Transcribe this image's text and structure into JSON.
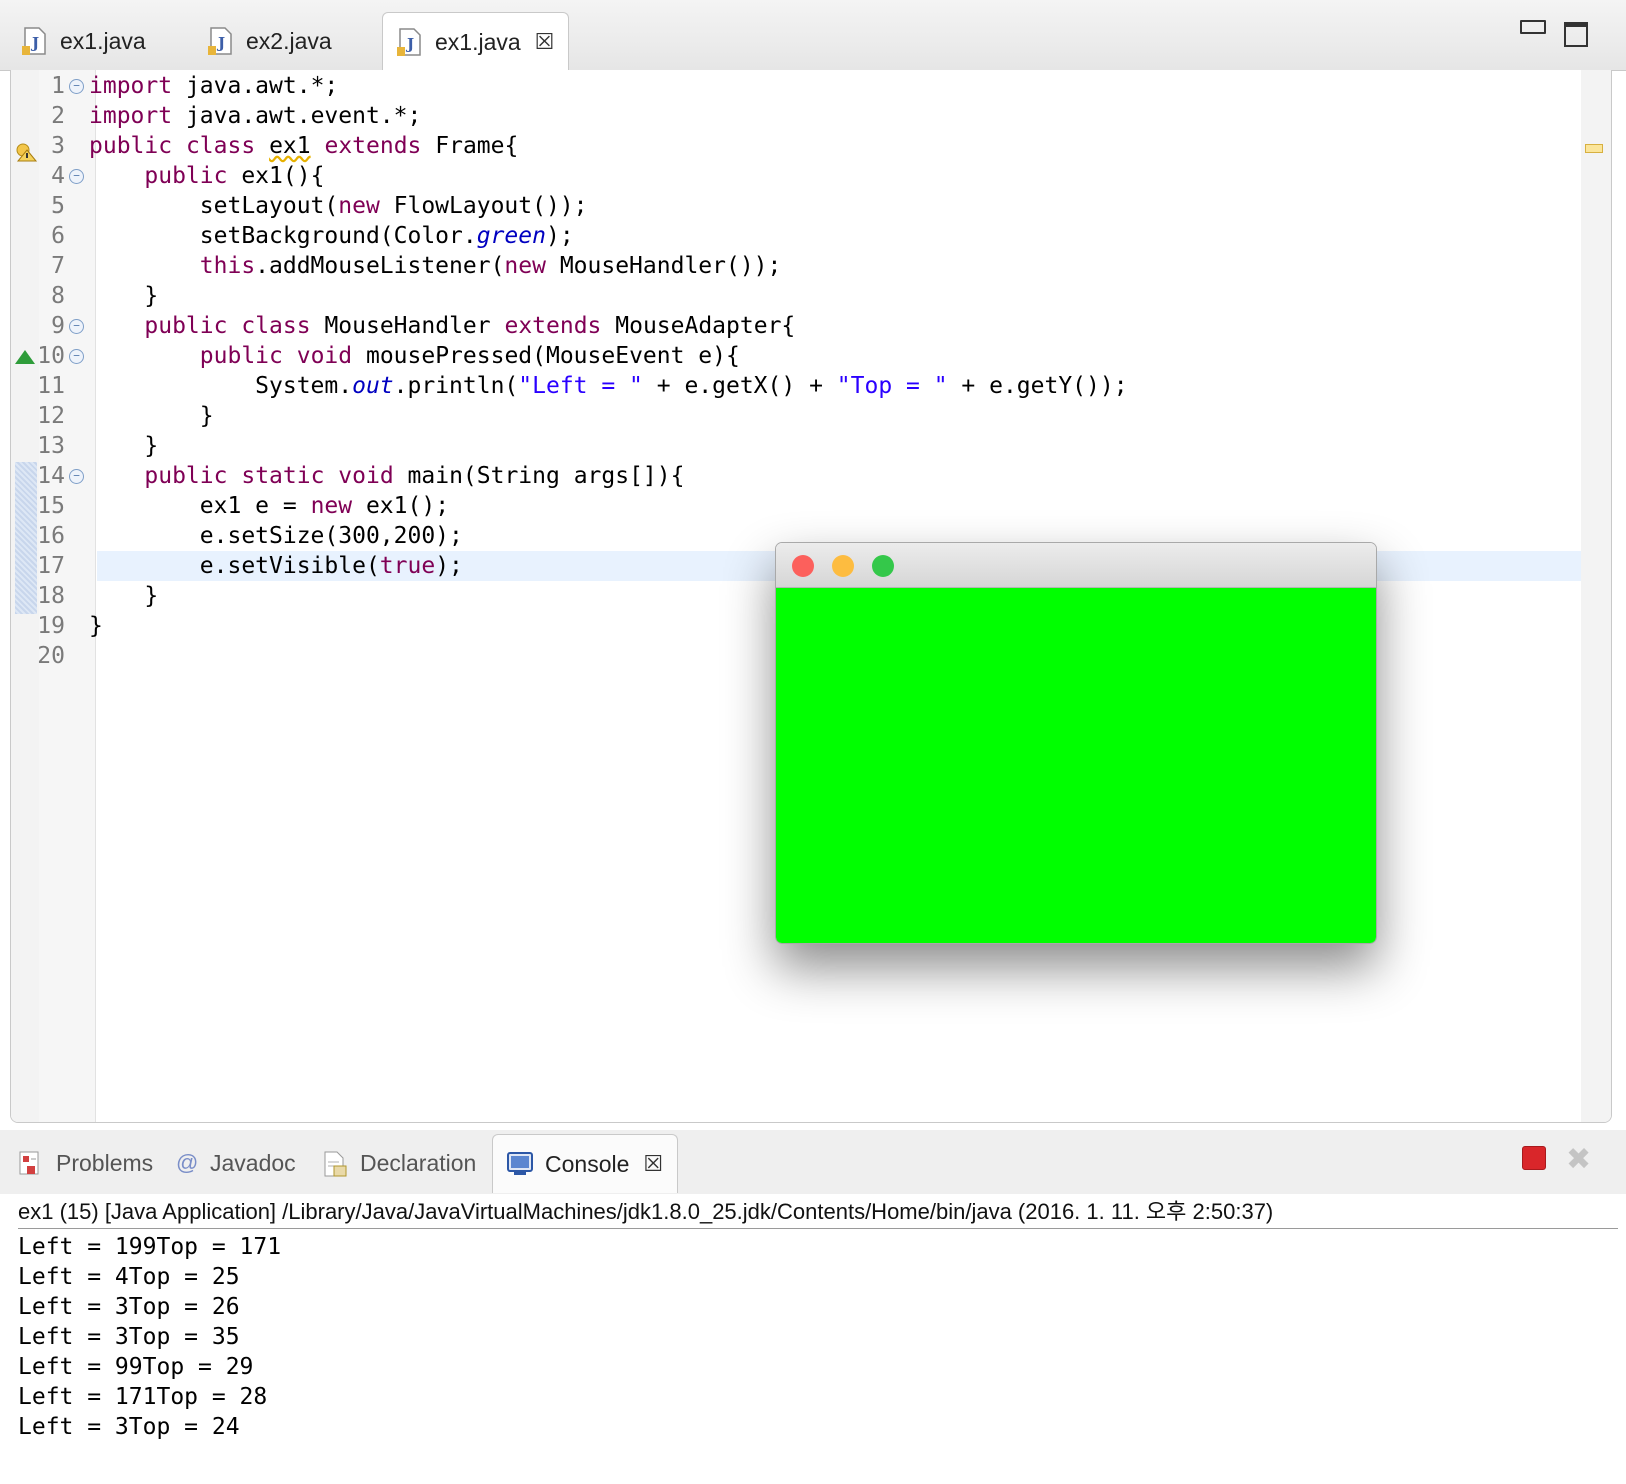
{
  "editor_tabs": [
    {
      "label": "ex1.java"
    },
    {
      "label": "ex2.java"
    },
    {
      "label": "ex1.java",
      "active": true
    }
  ],
  "editor": {
    "line_numbers": [
      "1",
      "2",
      "3",
      "4",
      "5",
      "6",
      "7",
      "8",
      "9",
      "10",
      "11",
      "12",
      "13",
      "14",
      "15",
      "16",
      "17",
      "18",
      "19",
      "20"
    ],
    "current_line": 17,
    "code_lines": [
      [
        {
          "t": "import",
          "c": "kw"
        },
        {
          "t": " java.awt.*;"
        }
      ],
      [
        {
          "t": "import",
          "c": "kw"
        },
        {
          "t": " java.awt.event.*;"
        }
      ],
      [
        {
          "t": "public",
          "c": "kw"
        },
        {
          "t": " "
        },
        {
          "t": "class",
          "c": "kw"
        },
        {
          "t": " "
        },
        {
          "t": "ex1",
          "c": "warn"
        },
        {
          "t": " "
        },
        {
          "t": "extends",
          "c": "kw"
        },
        {
          "t": " Frame{"
        }
      ],
      [
        {
          "t": "    "
        },
        {
          "t": "public",
          "c": "kw"
        },
        {
          "t": " ex1(){"
        }
      ],
      [
        {
          "t": "        setLayout("
        },
        {
          "t": "new",
          "c": "kw"
        },
        {
          "t": " FlowLayout());"
        }
      ],
      [
        {
          "t": "        setBackground(Color."
        },
        {
          "t": "green",
          "c": "fld"
        },
        {
          "t": ");"
        }
      ],
      [
        {
          "t": "        "
        },
        {
          "t": "this",
          "c": "kw"
        },
        {
          "t": ".addMouseListener("
        },
        {
          "t": "new",
          "c": "kw"
        },
        {
          "t": " MouseHandler());"
        }
      ],
      [
        {
          "t": "    }"
        }
      ],
      [
        {
          "t": "    "
        },
        {
          "t": "public",
          "c": "kw"
        },
        {
          "t": " "
        },
        {
          "t": "class",
          "c": "kw"
        },
        {
          "t": " MouseHandler "
        },
        {
          "t": "extends",
          "c": "kw"
        },
        {
          "t": " MouseAdapter{"
        }
      ],
      [
        {
          "t": "        "
        },
        {
          "t": "public",
          "c": "kw"
        },
        {
          "t": " "
        },
        {
          "t": "void",
          "c": "kw"
        },
        {
          "t": " mousePressed(MouseEvent e){"
        }
      ],
      [
        {
          "t": "            System."
        },
        {
          "t": "out",
          "c": "fld"
        },
        {
          "t": ".println("
        },
        {
          "t": "\"Left = \"",
          "c": "str"
        },
        {
          "t": " + e.getX() + "
        },
        {
          "t": "\"Top = \"",
          "c": "str"
        },
        {
          "t": " + e.getY());"
        }
      ],
      [
        {
          "t": "        }"
        }
      ],
      [
        {
          "t": "    }"
        }
      ],
      [
        {
          "t": "    "
        },
        {
          "t": "public",
          "c": "kw"
        },
        {
          "t": " "
        },
        {
          "t": "static",
          "c": "kw"
        },
        {
          "t": " "
        },
        {
          "t": "void",
          "c": "kw"
        },
        {
          "t": " main(String args[]){"
        }
      ],
      [
        {
          "t": "        ex1 e = "
        },
        {
          "t": "new",
          "c": "kw"
        },
        {
          "t": " ex1();"
        }
      ],
      [
        {
          "t": "        e.setSize(300,200);"
        }
      ],
      [
        {
          "t": "        e.setVisible("
        },
        {
          "t": "true",
          "c": "kw"
        },
        {
          "t": ");"
        }
      ],
      [
        {
          "t": "    }"
        }
      ],
      [
        {
          "t": "}"
        }
      ],
      [
        {
          "t": ""
        }
      ]
    ],
    "fold_lines": [
      1,
      4,
      9,
      10,
      14
    ]
  },
  "frame_window": {
    "background_color": "#00ff00",
    "close_color": "#fc605c",
    "minimize_color": "#fdbc40",
    "zoom_color": "#34c84a"
  },
  "views_tabs": [
    {
      "label": "Problems",
      "icon": "problems-icon"
    },
    {
      "label": "Javadoc",
      "icon": "javadoc-icon"
    },
    {
      "label": "Declaration",
      "icon": "declaration-icon"
    },
    {
      "label": "Console",
      "icon": "console-icon",
      "active": true
    }
  ],
  "console": {
    "header": "ex1 (15) [Java Application] /Library/Java/JavaVirtualMachines/jdk1.8.0_25.jdk/Contents/Home/bin/java (2016. 1. 11. 오후 2:50:37)",
    "lines": [
      "Left = 199Top = 171",
      "Left = 4Top = 25",
      "Left = 3Top = 26",
      "Left = 3Top = 35",
      "Left = 99Top = 29",
      "Left = 171Top = 28",
      "Left = 3Top = 24"
    ]
  }
}
